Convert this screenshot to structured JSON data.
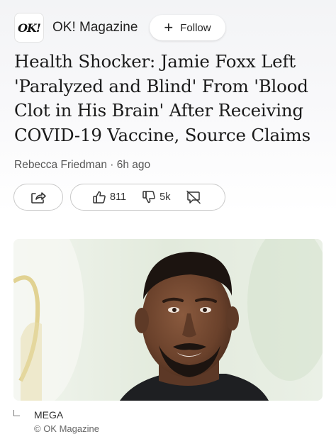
{
  "header": {
    "logo_text": "OK!",
    "publisher_name": "OK! Magazine",
    "follow_label": "Follow"
  },
  "article": {
    "headline": "Health Shocker: Jamie Foxx Left 'Paralyzed and Blind' From 'Blood Clot in His Brain' After Receiving COVID-19 Vaccine, Source Claims",
    "author": "Rebecca Friedman",
    "separator": "·",
    "time_ago": "6h ago",
    "byline": "Rebecca Friedman · 6h ago"
  },
  "actions": {
    "share_icon": "share-icon",
    "like_icon": "thumbs-up-icon",
    "like_count": "811",
    "dislike_icon": "thumbs-down-icon",
    "dislike_count": "5k",
    "comment_icon": "comment-off-icon"
  },
  "image": {
    "caption": "MEGA",
    "credit": "© OK Magazine"
  },
  "colors": {
    "text": "#1a1a1a",
    "secondary_text": "#555555",
    "border": "#c9c9c9",
    "photo_bg": "#e4ecdf"
  }
}
